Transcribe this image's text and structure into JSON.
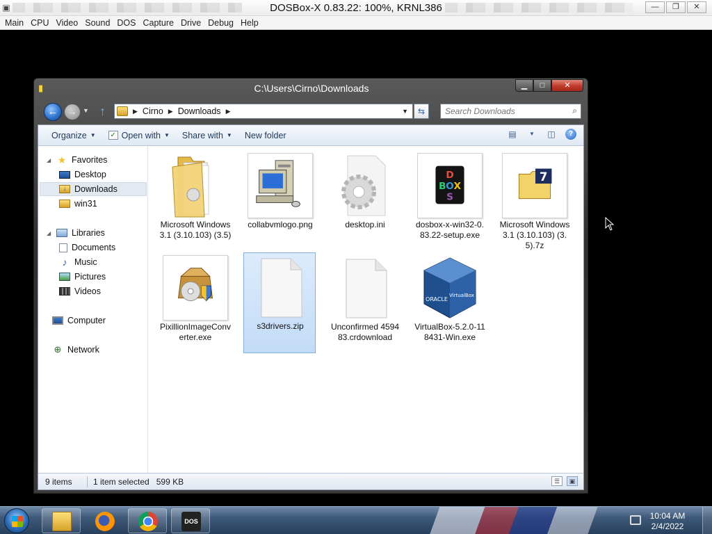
{
  "host": {
    "title": "DOSBox-X 0.83.22: 100%, KRNL386",
    "menu": [
      "Main",
      "CPU",
      "Video",
      "Sound",
      "DOS",
      "Capture",
      "Drive",
      "Debug",
      "Help"
    ],
    "controls": {
      "minimize": "—",
      "restore": "❐",
      "close": "✕"
    }
  },
  "explorer": {
    "title": "C:\\Users\\Cirno\\Downloads",
    "breadcrumb": [
      "Cirno",
      "Downloads"
    ],
    "search_placeholder": "Search Downloads",
    "toolbar": {
      "organize": "Organize",
      "open_with": "Open with",
      "share_with": "Share with",
      "new_folder": "New folder"
    },
    "nav": {
      "favorites": "Favorites",
      "desktop": "Desktop",
      "downloads": "Downloads",
      "win31": "win31",
      "libraries": "Libraries",
      "documents": "Documents",
      "music": "Music",
      "pictures": "Pictures",
      "videos": "Videos",
      "computer": "Computer",
      "network": "Network"
    },
    "files": [
      {
        "name": "Microsoft Windows 3.1 (3.10.103) (3.5)",
        "icon": "folder-icon"
      },
      {
        "name": "collabvmlogo.png",
        "icon": "computer-thumbnail"
      },
      {
        "name": "desktop.ini",
        "icon": "settings-file-icon"
      },
      {
        "name": "dosbox-x-win32-0.83.22-setup.exe",
        "icon": "dosbox-icon"
      },
      {
        "name": "Microsoft Windows 3.1 (3.10.103) (3.5).7z",
        "icon": "7zip-icon"
      },
      {
        "name": "PixillionImageConverter.exe",
        "icon": "installer-icon"
      },
      {
        "name": "s3drivers.zip",
        "icon": "blank-file-icon"
      },
      {
        "name": "Unconfirmed 459483.crdownload",
        "icon": "blank-file-icon"
      },
      {
        "name": "VirtualBox-5.2.0-118431-Win.exe",
        "icon": "virtualbox-icon"
      }
    ],
    "status": {
      "count": "9 items",
      "selection": "1 item selected",
      "size": "599 KB"
    }
  },
  "taskbar": {
    "time": "10:04 AM",
    "date": "2/4/2022",
    "apps": [
      "windows-explorer",
      "firefox",
      "chrome",
      "dosbox"
    ],
    "dosbox_glyph": "DOS BOX"
  },
  "colors": {
    "accent": "#2a68b5",
    "selection": "#cfe0f5",
    "window_frame": "#3a3a3a",
    "taskbar": "#3e5978"
  }
}
